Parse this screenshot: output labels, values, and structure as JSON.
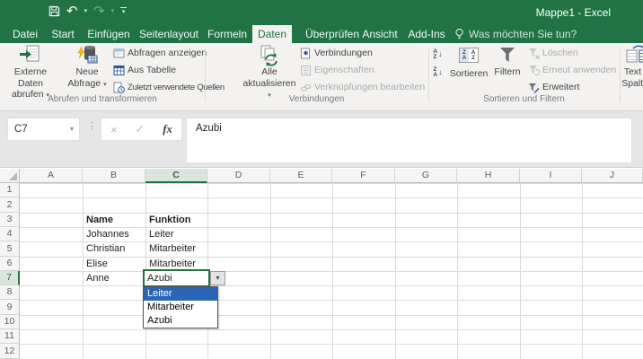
{
  "titlebar": {
    "title": "Mappe1 - Excel"
  },
  "tabs": [
    {
      "label": "Datei",
      "active": false
    },
    {
      "label": "Start",
      "active": false
    },
    {
      "label": "Einfügen",
      "active": false
    },
    {
      "label": "Seitenlayout",
      "active": false
    },
    {
      "label": "Formeln",
      "active": false
    },
    {
      "label": "Daten",
      "active": true
    },
    {
      "label": "Überprüfen",
      "active": false
    },
    {
      "label": "Ansicht",
      "active": false
    },
    {
      "label": "Add-Ins",
      "active": false
    }
  ],
  "tell_me": {
    "label": "Was möchten Sie tun?"
  },
  "ribbon": {
    "groups": [
      {
        "label": "Abrufen und transformieren"
      },
      {
        "label": "Verbindungen"
      },
      {
        "label": "Sortieren und Filtern"
      }
    ],
    "buttons": {
      "externe_daten_line1": "Externe Daten",
      "externe_daten_line2": "abrufen",
      "neue_abfrage_line1": "Neue",
      "neue_abfrage_line2": "Abfrage",
      "abfragen_anzeigen": "Abfragen anzeigen",
      "aus_tabelle": "Aus Tabelle",
      "zuletzt_quellen": "Zuletzt verwendete Quellen",
      "alle_aktualisieren_line1": "Alle",
      "alle_aktualisieren_line2": "aktualisieren",
      "verbindungen": "Verbindungen",
      "eigenschaften": "Eigenschaften",
      "verknuepfungen": "Verknüpfungen bearbeiten",
      "sortieren": "Sortieren",
      "filtern": "Filtern",
      "loeschen": "Löschen",
      "erneut_anwenden": "Erneut anwenden",
      "erweitert": "Erweitert",
      "text_in_spalten_line1": "Text in",
      "text_in_spalten_line2": "Spalten"
    }
  },
  "formula_bar": {
    "name_box": "C7",
    "formula": "Azubi"
  },
  "grid": {
    "columns": [
      "A",
      "B",
      "C",
      "D",
      "E",
      "F",
      "G",
      "H",
      "I",
      "J"
    ],
    "rows": [
      "1",
      "2",
      "3",
      "4",
      "5",
      "6",
      "7",
      "8",
      "9",
      "10",
      "11",
      "12"
    ],
    "active_column": "C",
    "active_row": "7",
    "cells": [
      {
        "ref": "B3",
        "text": "Name",
        "bold": true
      },
      {
        "ref": "C3",
        "text": "Funktion",
        "bold": true
      },
      {
        "ref": "B4",
        "text": "Johannes",
        "bold": false
      },
      {
        "ref": "C4",
        "text": "Leiter",
        "bold": false
      },
      {
        "ref": "B5",
        "text": "Christian",
        "bold": false
      },
      {
        "ref": "C5",
        "text": "Mitarbeiter",
        "bold": false
      },
      {
        "ref": "B6",
        "text": "Elise",
        "bold": false
      },
      {
        "ref": "C6",
        "text": "Mitarbeiter",
        "bold": false
      },
      {
        "ref": "B7",
        "text": "Anne",
        "bold": false
      }
    ],
    "active_cell": {
      "ref": "C7",
      "value": "Azubi"
    }
  },
  "dropdown": {
    "items": [
      "Leiter",
      "Mitarbeiter",
      "Azubi"
    ],
    "highlighted": "Leiter"
  },
  "icons": {
    "caret_down": "▾",
    "undo": "↶",
    "redo": "↷",
    "dots": "⋮",
    "cancel": "×",
    "confirm": "✓",
    "fx": "fx",
    "arrow_down": "↓",
    "letter_a": "A",
    "letter_z": "Z"
  },
  "colors": {
    "excel_green": "#217346",
    "selection_blue": "#2a65b8",
    "disabled_text": "#ababab"
  }
}
